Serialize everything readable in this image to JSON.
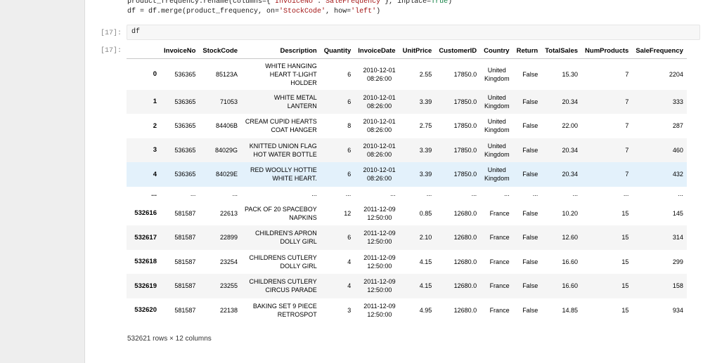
{
  "code_lines": {
    "line1_a": "product_frequency.rename(columns={",
    "line1_str1": "'InvoiceNo'",
    "line1_b": ":",
    "line1_str2": "'SaleFrequency'",
    "line1_c": "}, inplace=",
    "line1_true": "True",
    "line1_d": ")",
    "line2_a": "df = df.merge(product_frequency, on=",
    "line2_str1": "'StockCode'",
    "line2_b": ", how=",
    "line2_str2": "'left'",
    "line2_c": ")"
  },
  "cell_in": {
    "prompt": "[17]:",
    "code": "df"
  },
  "cell_out": {
    "prompt": "[17]:"
  },
  "table": {
    "columns": [
      "InvoiceNo",
      "StockCode",
      "Description",
      "Quantity",
      "InvoiceDate",
      "UnitPrice",
      "CustomerID",
      "Country",
      "Return",
      "TotalSales",
      "NumProducts",
      "SaleFrequency"
    ],
    "rows": [
      {
        "index": "0",
        "InvoiceNo": "536365",
        "StockCode": "85123A",
        "Description": "WHITE HANGING\nHEART T-LIGHT\nHOLDER",
        "Quantity": "6",
        "InvoiceDate": "2010-12-01\n08:26:00",
        "UnitPrice": "2.55",
        "CustomerID": "17850.0",
        "Country": "United\nKingdom",
        "Return": "False",
        "TotalSales": "15.30",
        "NumProducts": "7",
        "SaleFrequency": "2204"
      },
      {
        "index": "1",
        "InvoiceNo": "536365",
        "StockCode": "71053",
        "Description": "WHITE METAL\nLANTERN",
        "Quantity": "6",
        "InvoiceDate": "2010-12-01\n08:26:00",
        "UnitPrice": "3.39",
        "CustomerID": "17850.0",
        "Country": "United\nKingdom",
        "Return": "False",
        "TotalSales": "20.34",
        "NumProducts": "7",
        "SaleFrequency": "333"
      },
      {
        "index": "2",
        "InvoiceNo": "536365",
        "StockCode": "84406B",
        "Description": "CREAM CUPID HEARTS\nCOAT HANGER",
        "Quantity": "8",
        "InvoiceDate": "2010-12-01\n08:26:00",
        "UnitPrice": "2.75",
        "CustomerID": "17850.0",
        "Country": "United\nKingdom",
        "Return": "False",
        "TotalSales": "22.00",
        "NumProducts": "7",
        "SaleFrequency": "287"
      },
      {
        "index": "3",
        "InvoiceNo": "536365",
        "StockCode": "84029G",
        "Description": "KNITTED UNION FLAG\nHOT WATER BOTTLE",
        "Quantity": "6",
        "InvoiceDate": "2010-12-01\n08:26:00",
        "UnitPrice": "3.39",
        "CustomerID": "17850.0",
        "Country": "United\nKingdom",
        "Return": "False",
        "TotalSales": "20.34",
        "NumProducts": "7",
        "SaleFrequency": "460"
      },
      {
        "index": "4",
        "InvoiceNo": "536365",
        "StockCode": "84029E",
        "Description": "RED WOOLLY HOTTIE\nWHITE HEART.",
        "Quantity": "6",
        "InvoiceDate": "2010-12-01\n08:26:00",
        "UnitPrice": "3.39",
        "CustomerID": "17850.0",
        "Country": "United\nKingdom",
        "Return": "False",
        "TotalSales": "20.34",
        "NumProducts": "7",
        "SaleFrequency": "432"
      },
      {
        "index": "...",
        "InvoiceNo": "...",
        "StockCode": "...",
        "Description": "...",
        "Quantity": "...",
        "InvoiceDate": "...",
        "UnitPrice": "...",
        "CustomerID": "...",
        "Country": "...",
        "Return": "...",
        "TotalSales": "...",
        "NumProducts": "...",
        "SaleFrequency": "..."
      },
      {
        "index": "532616",
        "InvoiceNo": "581587",
        "StockCode": "22613",
        "Description": "PACK OF 20 SPACEBOY\nNAPKINS",
        "Quantity": "12",
        "InvoiceDate": "2011-12-09\n12:50:00",
        "UnitPrice": "0.85",
        "CustomerID": "12680.0",
        "Country": "France",
        "Return": "False",
        "TotalSales": "10.20",
        "NumProducts": "15",
        "SaleFrequency": "145"
      },
      {
        "index": "532617",
        "InvoiceNo": "581587",
        "StockCode": "22899",
        "Description": "CHILDREN'S APRON\nDOLLY GIRL",
        "Quantity": "6",
        "InvoiceDate": "2011-12-09\n12:50:00",
        "UnitPrice": "2.10",
        "CustomerID": "12680.0",
        "Country": "France",
        "Return": "False",
        "TotalSales": "12.60",
        "NumProducts": "15",
        "SaleFrequency": "314"
      },
      {
        "index": "532618",
        "InvoiceNo": "581587",
        "StockCode": "23254",
        "Description": "CHILDRENS CUTLERY\nDOLLY GIRL",
        "Quantity": "4",
        "InvoiceDate": "2011-12-09\n12:50:00",
        "UnitPrice": "4.15",
        "CustomerID": "12680.0",
        "Country": "France",
        "Return": "False",
        "TotalSales": "16.60",
        "NumProducts": "15",
        "SaleFrequency": "299"
      },
      {
        "index": "532619",
        "InvoiceNo": "581587",
        "StockCode": "23255",
        "Description": "CHILDRENS CUTLERY\nCIRCUS PARADE",
        "Quantity": "4",
        "InvoiceDate": "2011-12-09\n12:50:00",
        "UnitPrice": "4.15",
        "CustomerID": "12680.0",
        "Country": "France",
        "Return": "False",
        "TotalSales": "16.60",
        "NumProducts": "15",
        "SaleFrequency": "158"
      },
      {
        "index": "532620",
        "InvoiceNo": "581587",
        "StockCode": "22138",
        "Description": "BAKING SET 9 PIECE\nRETROSPOT",
        "Quantity": "3",
        "InvoiceDate": "2011-12-09\n12:50:00",
        "UnitPrice": "4.95",
        "CustomerID": "12680.0",
        "Country": "France",
        "Return": "False",
        "TotalSales": "14.85",
        "NumProducts": "15",
        "SaleFrequency": "934"
      }
    ]
  },
  "footer": "532621 rows × 12 columns",
  "colors": {
    "background": "#eeeeee",
    "stripe": "#f5f5f5",
    "hover": "#e3f1fb"
  }
}
